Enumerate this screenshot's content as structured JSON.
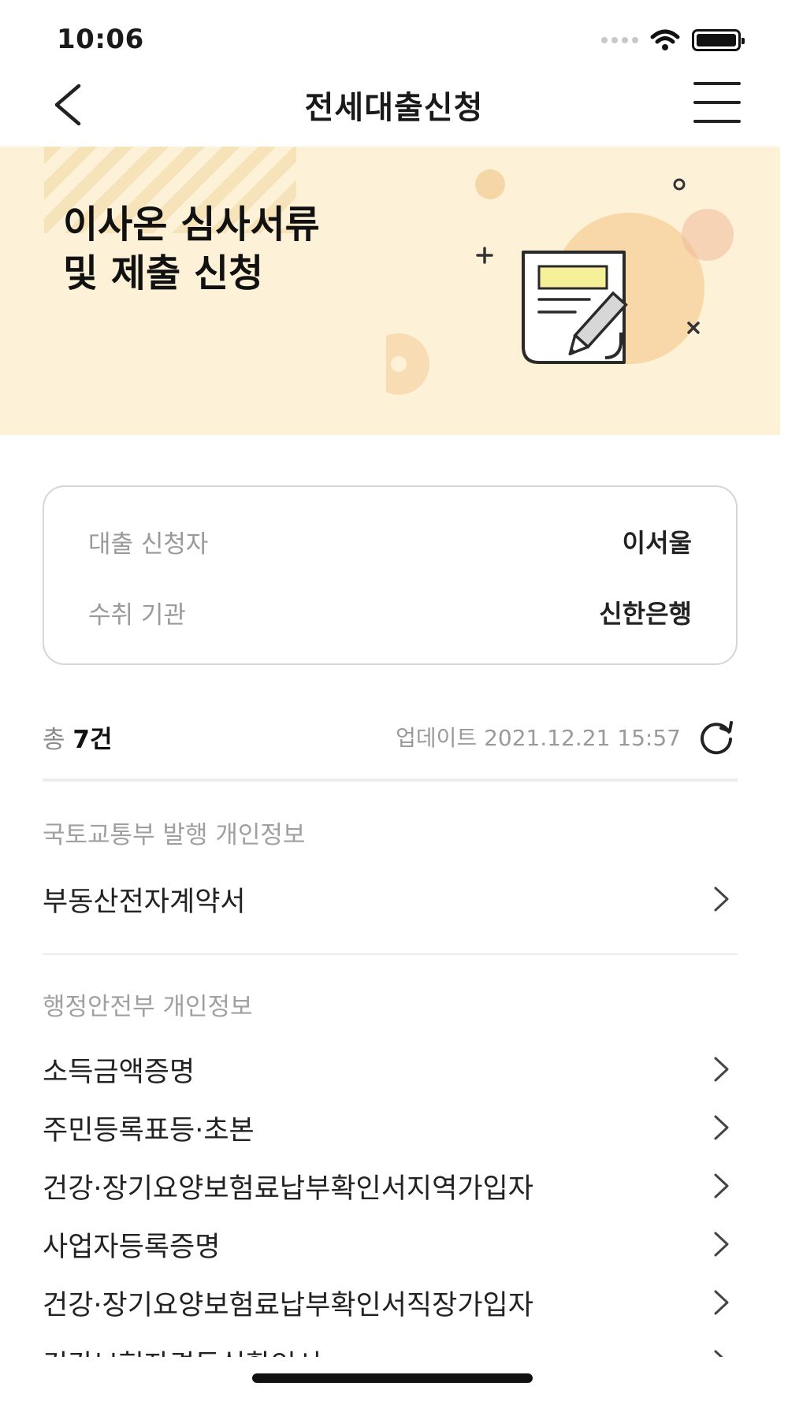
{
  "status_bar": {
    "time": "10:06"
  },
  "nav": {
    "title": "전세대출신청"
  },
  "banner": {
    "title_line1": "이사온 심사서류",
    "title_line2": "및 제출 신청"
  },
  "info": {
    "applicant_label": "대출 신청자",
    "applicant_value": "이서울",
    "institution_label": "수취 기관",
    "institution_value": "신한은행"
  },
  "summary": {
    "total_prefix": "총",
    "total_count": "7건",
    "update_text": "업데이트 2021.12.21 15:57"
  },
  "sections": [
    {
      "title": "국토교통부 발행 개인정보",
      "items": [
        "부동산전자계약서"
      ]
    },
    {
      "title": "행정안전부 개인정보",
      "items": [
        "소득금액증명",
        "주민등록표등·초본",
        "건강·장기요양보험료납부확인서지역가입자",
        "사업자등록증명",
        "건강·장기요양보험료납부확인서직장가입자",
        "건강보험자격득실확인서"
      ]
    }
  ],
  "colors": {
    "banner_bg": "#fdf1d8",
    "accent_circle": "#f6cf98",
    "doc_highlight": "#f6ef9a"
  },
  "icons": [
    "back-icon",
    "menu-icon",
    "refresh-icon",
    "chevron-right-icon",
    "document-pencil-icon",
    "wifi-icon",
    "battery-icon"
  ]
}
